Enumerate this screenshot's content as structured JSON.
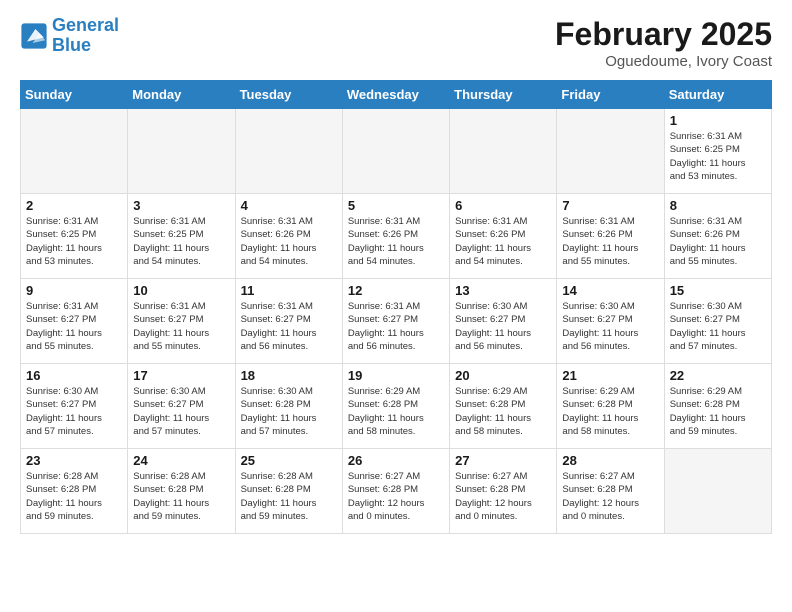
{
  "header": {
    "logo_line1": "General",
    "logo_line2": "Blue",
    "month_year": "February 2025",
    "location": "Oguedoume, Ivory Coast"
  },
  "weekdays": [
    "Sunday",
    "Monday",
    "Tuesday",
    "Wednesday",
    "Thursday",
    "Friday",
    "Saturday"
  ],
  "weeks": [
    [
      {
        "day": "",
        "info": ""
      },
      {
        "day": "",
        "info": ""
      },
      {
        "day": "",
        "info": ""
      },
      {
        "day": "",
        "info": ""
      },
      {
        "day": "",
        "info": ""
      },
      {
        "day": "",
        "info": ""
      },
      {
        "day": "1",
        "info": "Sunrise: 6:31 AM\nSunset: 6:25 PM\nDaylight: 11 hours\nand 53 minutes."
      }
    ],
    [
      {
        "day": "2",
        "info": "Sunrise: 6:31 AM\nSunset: 6:25 PM\nDaylight: 11 hours\nand 53 minutes."
      },
      {
        "day": "3",
        "info": "Sunrise: 6:31 AM\nSunset: 6:25 PM\nDaylight: 11 hours\nand 54 minutes."
      },
      {
        "day": "4",
        "info": "Sunrise: 6:31 AM\nSunset: 6:26 PM\nDaylight: 11 hours\nand 54 minutes."
      },
      {
        "day": "5",
        "info": "Sunrise: 6:31 AM\nSunset: 6:26 PM\nDaylight: 11 hours\nand 54 minutes."
      },
      {
        "day": "6",
        "info": "Sunrise: 6:31 AM\nSunset: 6:26 PM\nDaylight: 11 hours\nand 54 minutes."
      },
      {
        "day": "7",
        "info": "Sunrise: 6:31 AM\nSunset: 6:26 PM\nDaylight: 11 hours\nand 55 minutes."
      },
      {
        "day": "8",
        "info": "Sunrise: 6:31 AM\nSunset: 6:26 PM\nDaylight: 11 hours\nand 55 minutes."
      }
    ],
    [
      {
        "day": "9",
        "info": "Sunrise: 6:31 AM\nSunset: 6:27 PM\nDaylight: 11 hours\nand 55 minutes."
      },
      {
        "day": "10",
        "info": "Sunrise: 6:31 AM\nSunset: 6:27 PM\nDaylight: 11 hours\nand 55 minutes."
      },
      {
        "day": "11",
        "info": "Sunrise: 6:31 AM\nSunset: 6:27 PM\nDaylight: 11 hours\nand 56 minutes."
      },
      {
        "day": "12",
        "info": "Sunrise: 6:31 AM\nSunset: 6:27 PM\nDaylight: 11 hours\nand 56 minutes."
      },
      {
        "day": "13",
        "info": "Sunrise: 6:30 AM\nSunset: 6:27 PM\nDaylight: 11 hours\nand 56 minutes."
      },
      {
        "day": "14",
        "info": "Sunrise: 6:30 AM\nSunset: 6:27 PM\nDaylight: 11 hours\nand 56 minutes."
      },
      {
        "day": "15",
        "info": "Sunrise: 6:30 AM\nSunset: 6:27 PM\nDaylight: 11 hours\nand 57 minutes."
      }
    ],
    [
      {
        "day": "16",
        "info": "Sunrise: 6:30 AM\nSunset: 6:27 PM\nDaylight: 11 hours\nand 57 minutes."
      },
      {
        "day": "17",
        "info": "Sunrise: 6:30 AM\nSunset: 6:27 PM\nDaylight: 11 hours\nand 57 minutes."
      },
      {
        "day": "18",
        "info": "Sunrise: 6:30 AM\nSunset: 6:28 PM\nDaylight: 11 hours\nand 57 minutes."
      },
      {
        "day": "19",
        "info": "Sunrise: 6:29 AM\nSunset: 6:28 PM\nDaylight: 11 hours\nand 58 minutes."
      },
      {
        "day": "20",
        "info": "Sunrise: 6:29 AM\nSunset: 6:28 PM\nDaylight: 11 hours\nand 58 minutes."
      },
      {
        "day": "21",
        "info": "Sunrise: 6:29 AM\nSunset: 6:28 PM\nDaylight: 11 hours\nand 58 minutes."
      },
      {
        "day": "22",
        "info": "Sunrise: 6:29 AM\nSunset: 6:28 PM\nDaylight: 11 hours\nand 59 minutes."
      }
    ],
    [
      {
        "day": "23",
        "info": "Sunrise: 6:28 AM\nSunset: 6:28 PM\nDaylight: 11 hours\nand 59 minutes."
      },
      {
        "day": "24",
        "info": "Sunrise: 6:28 AM\nSunset: 6:28 PM\nDaylight: 11 hours\nand 59 minutes."
      },
      {
        "day": "25",
        "info": "Sunrise: 6:28 AM\nSunset: 6:28 PM\nDaylight: 11 hours\nand 59 minutes."
      },
      {
        "day": "26",
        "info": "Sunrise: 6:27 AM\nSunset: 6:28 PM\nDaylight: 12 hours\nand 0 minutes."
      },
      {
        "day": "27",
        "info": "Sunrise: 6:27 AM\nSunset: 6:28 PM\nDaylight: 12 hours\nand 0 minutes."
      },
      {
        "day": "28",
        "info": "Sunrise: 6:27 AM\nSunset: 6:28 PM\nDaylight: 12 hours\nand 0 minutes."
      },
      {
        "day": "",
        "info": ""
      }
    ]
  ]
}
